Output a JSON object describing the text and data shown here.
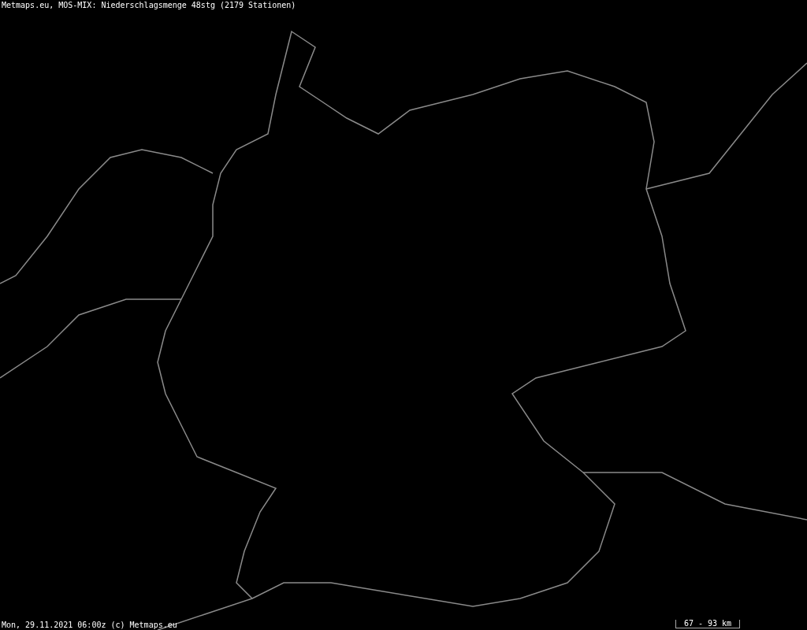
{
  "title": "Metmaps.eu, MOS-MIX: Niederschlagsmenge 48stg (2179 Stationen)",
  "footer": "Mon, 29.11.2021 06:00z (c) Metmaps.eu",
  "scale_bar": {
    "label": "67 - 93 km"
  }
}
